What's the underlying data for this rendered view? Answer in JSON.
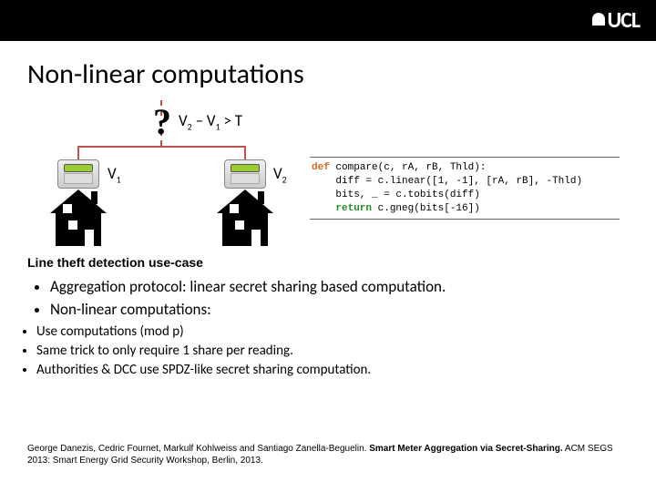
{
  "logo": "UCL",
  "title": "Non-linear computations",
  "query_mark": "?",
  "query_expr_v2": "V",
  "query_expr_sub2": "2",
  "query_expr_dash": " – ",
  "query_expr_v1": "V",
  "query_expr_sub1": "1",
  "query_expr_tail": " > T",
  "label_v1": "V",
  "label_v1_sub": "1",
  "label_v2": "V",
  "label_v2_sub": "2",
  "code": {
    "l1a": "def",
    "l1b": " compare(c, rA, rB, Thld):",
    "l2": "    diff = c.linear([1, -1], [rA, rB], -Thld)",
    "l3": "    bits, _ = c.tobits(diff)",
    "l4a": "    return",
    "l4b": " c.gneg(bits[-16])"
  },
  "usecase": "Line theft detection use-case",
  "bullets": {
    "b1": "Aggregation protocol: linear secret sharing based computation.",
    "b2": "Non-linear computations:",
    "s1": "Use computations (mod p)",
    "s2": "Same trick to only require 1 share per reading.",
    "s3": "Authorities & DCC use SPDZ-like secret sharing computation."
  },
  "citation_authors": "George Danezis, Cedric Fournet, Markulf Kohlweiss and Santiago Zanella-Beguelin. ",
  "citation_title": "Smart Meter Aggregation via Secret-Sharing.",
  "citation_venue": " ACM SEGS 2013: Smart Energy Grid Security Workshop, Berlin, 2013."
}
